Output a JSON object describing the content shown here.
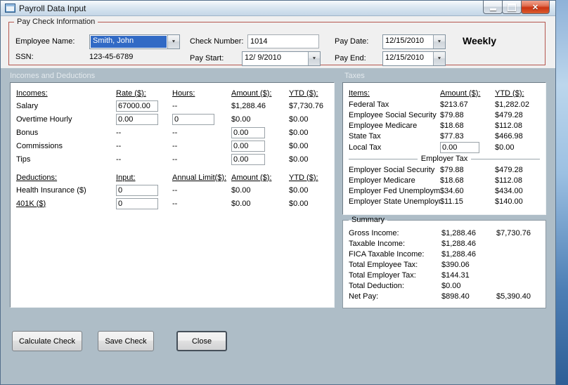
{
  "window": {
    "title": "Payroll Data Input"
  },
  "paycheck": {
    "legend": "Pay Check Information",
    "employee_name_label": "Employee Name:",
    "employee_name": "Smith, John",
    "ssn_label": "SSN:",
    "ssn": "123-45-6789",
    "check_number_label": "Check Number:",
    "check_number": "1014",
    "pay_start_label": "Pay Start:",
    "pay_start": "12/ 9/2010",
    "pay_date_label": "Pay Date:",
    "pay_date": "12/15/2010",
    "pay_end_label": "Pay End:",
    "pay_end": "12/15/2010",
    "frequency": "Weekly"
  },
  "sections": {
    "incomes_deductions": "Incomes and Deductions",
    "taxes": "Taxes"
  },
  "incomes": {
    "headers": {
      "name": "Incomes:",
      "rate": "Rate ($):",
      "hours": "Hours:",
      "amount": "Amount ($):",
      "ytd": "YTD ($):"
    },
    "salary": {
      "name": "Salary",
      "rate": "67000.00",
      "hours": "--",
      "amount": "$1,288.46",
      "ytd": "$7,730.76"
    },
    "overtime": {
      "name": "Overtime Hourly",
      "rate": "0.00",
      "hours": "0",
      "amount": "$0.00",
      "ytd": "$0.00"
    },
    "bonus": {
      "name": "Bonus",
      "rate": "--",
      "hours": "--",
      "amount": "0.00",
      "ytd": "$0.00"
    },
    "commissions": {
      "name": "Commissions",
      "rate": "--",
      "hours": "--",
      "amount": "0.00",
      "ytd": "$0.00"
    },
    "tips": {
      "name": "Tips",
      "rate": "--",
      "hours": "--",
      "amount": "0.00",
      "ytd": "$0.00"
    }
  },
  "deductions": {
    "headers": {
      "name": "Deductions:",
      "input": "Input:",
      "limit": "Annual Limit($):",
      "amount": "Amount ($):",
      "ytd": "YTD ($):"
    },
    "health": {
      "name": "Health Insurance ($)",
      "input": "0",
      "limit": "--",
      "amount": "$0.00",
      "ytd": "$0.00"
    },
    "k401": {
      "name": "401K ($)",
      "input": "0",
      "limit": "--",
      "amount": "$0.00",
      "ytd": "$0.00"
    }
  },
  "taxes": {
    "headers": {
      "items": "Items:",
      "amount": "Amount ($):",
      "ytd": "YTD ($):"
    },
    "rows": [
      {
        "name": "Federal Tax",
        "amount": "$213.67",
        "ytd": "$1,282.02"
      },
      {
        "name": "Employee Social Security",
        "amount": "$79.88",
        "ytd": "$479.28"
      },
      {
        "name": "Employee Medicare",
        "amount": "$18.68",
        "ytd": "$112.08"
      },
      {
        "name": "State Tax",
        "amount": "$77.83",
        "ytd": "$466.98"
      }
    ],
    "local": {
      "name": "Local Tax",
      "amount": "0.00",
      "ytd": "$0.00"
    },
    "employer_group": "Employer Tax",
    "employer_rows": [
      {
        "name": "Employer Social Security",
        "amount": "$79.88",
        "ytd": "$479.28"
      },
      {
        "name": "Employer Medicare",
        "amount": "$18.68",
        "ytd": "$112.08"
      },
      {
        "name": "Employer Fed Unemployment",
        "amount": "$34.60",
        "ytd": "$434.00"
      },
      {
        "name": "Employer State Unemployment",
        "amount": "$11.15",
        "ytd": "$140.00"
      }
    ]
  },
  "summary": {
    "legend": "Summary",
    "rows": [
      {
        "name": "Gross Income:",
        "amount": "$1,288.46",
        "ytd": "$7,730.76"
      },
      {
        "name": "Taxable Income:",
        "amount": "$1,288.46",
        "ytd": ""
      },
      {
        "name": "FICA Taxable Income:",
        "amount": "$1,288.46",
        "ytd": ""
      },
      {
        "name": "Total Employee Tax:",
        "amount": "$390.06",
        "ytd": ""
      },
      {
        "name": "Total Employer Tax:",
        "amount": "$144.31",
        "ytd": ""
      },
      {
        "name": "Total Deduction:",
        "amount": "$0.00",
        "ytd": ""
      },
      {
        "name": "Net Pay:",
        "amount": "$898.40",
        "ytd": "$5,390.40"
      }
    ]
  },
  "buttons": {
    "calculate": "Calculate Check",
    "save": "Save Check",
    "close": "Close"
  }
}
